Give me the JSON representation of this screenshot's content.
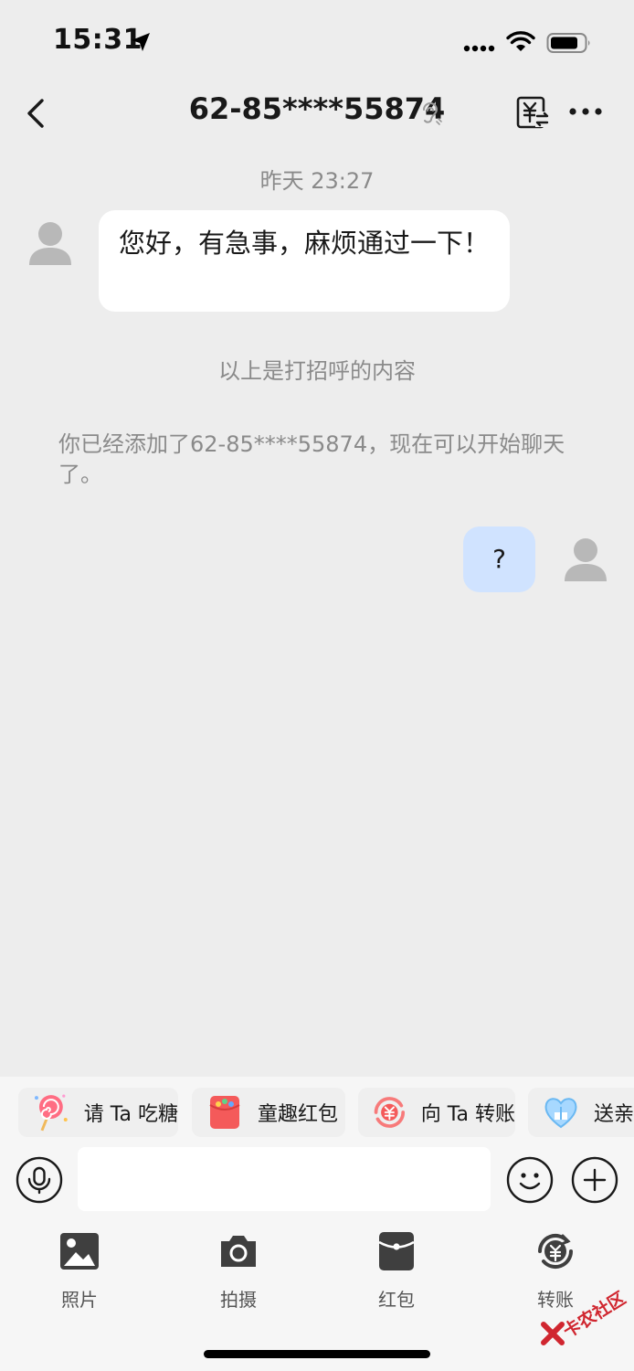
{
  "status_bar": {
    "time": "15:31"
  },
  "nav": {
    "title": "62-85****55874"
  },
  "messages": {
    "timestamp": "昨天 23:27",
    "incoming_text": "您好，有急事，麻烦通过一下！",
    "greeting_note": "以上是打招呼的内容",
    "added_note": "你已经添加了62-85****55874，现在可以开始聊天了。",
    "outgoing_text": "?"
  },
  "quick_actions": [
    {
      "label": "请 Ta 吃糖",
      "icon": "lollipop-icon"
    },
    {
      "label": "童趣红包",
      "icon": "red-packet-icon"
    },
    {
      "label": "向 Ta 转账",
      "icon": "transfer-icon"
    },
    {
      "label": "送亲密",
      "icon": "heart-gift-icon"
    }
  ],
  "input": {
    "value": "",
    "placeholder": ""
  },
  "toolbar": [
    {
      "label": "照片",
      "icon": "photo-icon"
    },
    {
      "label": "拍摄",
      "icon": "camera-icon"
    },
    {
      "label": "红包",
      "icon": "red-packet-icon"
    },
    {
      "label": "转账",
      "icon": "transfer-icon"
    }
  ],
  "watermark": {
    "text": "卡农社区"
  },
  "colors": {
    "background": "#ededed",
    "outgoing_bubble": "#d0e3ff",
    "incoming_bubble": "#ffffff",
    "panel": "#f6f6f6"
  }
}
